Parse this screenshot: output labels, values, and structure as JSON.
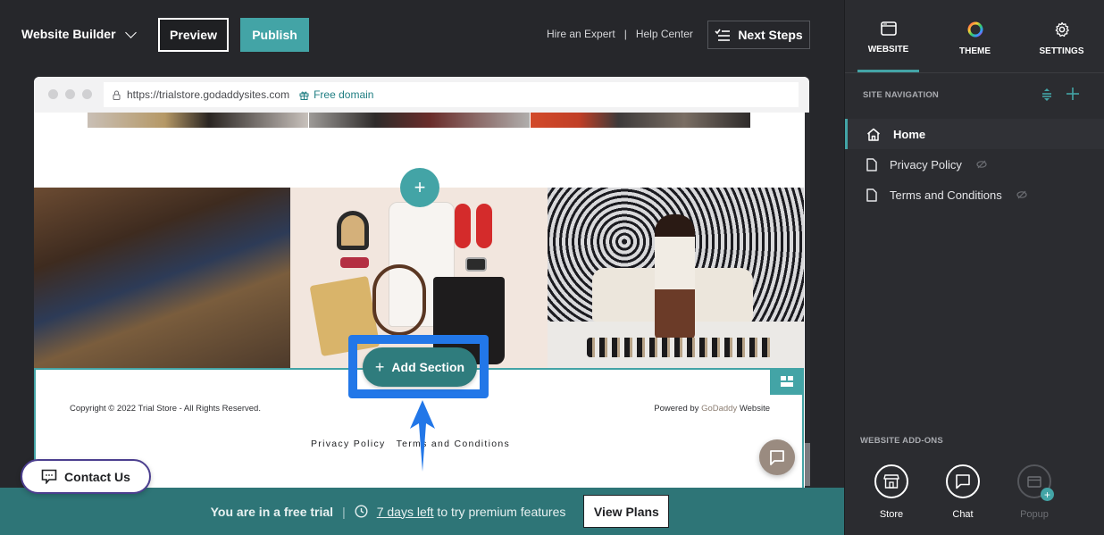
{
  "topbar": {
    "brand": "Website Builder",
    "preview_label": "Preview",
    "publish_label": "Publish",
    "hire_expert": "Hire an Expert",
    "link_separator": "|",
    "help_center": "Help Center",
    "next_steps": "Next Steps"
  },
  "browser": {
    "url": "https://trialstore.godaddysites.com",
    "free_domain": "Free domain"
  },
  "site": {
    "add_section_label": "Add Section",
    "add_plus": "+",
    "footer": {
      "copyright": "Copyright © 2022 Trial Store - All Rights Reserved.",
      "powered_prefix": "Powered by ",
      "powered_brand": "GoDaddy",
      "powered_suffix": " Website",
      "links": [
        "Privacy Policy",
        "Terms and Conditions"
      ]
    }
  },
  "contact": {
    "label": "Contact Us"
  },
  "trial_banner": {
    "status": "You are in a free trial",
    "separator": "|",
    "days_left": "7 days left",
    "suffix": " to try premium features",
    "view_plans": "View Plans"
  },
  "panel": {
    "tabs": [
      {
        "label": "WEBSITE",
        "icon": "browser-window-icon",
        "active": true
      },
      {
        "label": "THEME",
        "icon": "color-wheel-icon",
        "active": false
      },
      {
        "label": "SETTINGS",
        "icon": "gear-icon",
        "active": false
      }
    ],
    "site_navigation_title": "SITE NAVIGATION",
    "pages": [
      {
        "label": "Home",
        "icon": "home-icon",
        "active": true,
        "hidden": false
      },
      {
        "label": "Privacy Policy",
        "icon": "page-icon",
        "active": false,
        "hidden": true
      },
      {
        "label": "Terms and Conditions",
        "icon": "page-icon",
        "active": false,
        "hidden": true
      }
    ],
    "addons_title": "WEBSITE ADD-ONS",
    "addons": [
      {
        "label": "Store",
        "icon": "store-icon",
        "enabled": true
      },
      {
        "label": "Chat",
        "icon": "chat-icon",
        "enabled": true
      },
      {
        "label": "Popup",
        "icon": "popup-icon",
        "enabled": false
      }
    ]
  },
  "colors": {
    "accent": "#43a4a6",
    "banner": "#2e7577",
    "highlight": "#2277e8",
    "background": "#26272b"
  }
}
